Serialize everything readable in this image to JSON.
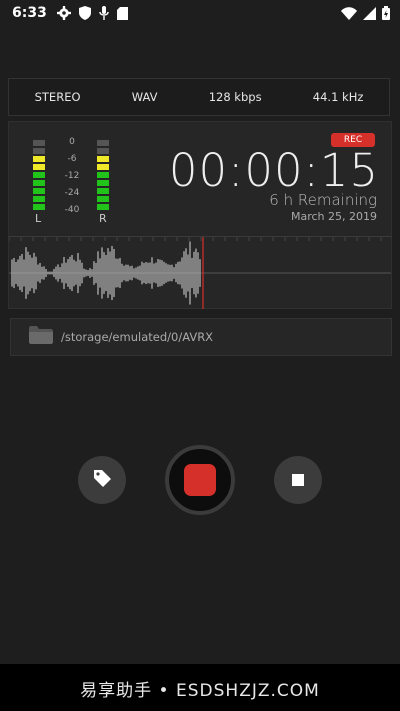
{
  "status_bar": {
    "time": "6:33"
  },
  "info": {
    "channels": "STEREO",
    "format": "WAV",
    "bitrate": "128 kbps",
    "sample_rate": "44.1 kHz"
  },
  "meter": {
    "scale": [
      "0",
      "-6",
      "-12",
      "-24",
      "-40"
    ],
    "left_label": "L",
    "right_label": "R",
    "left_level_segments": 7,
    "right_level_segments": 7,
    "total_segments": 9
  },
  "recording": {
    "badge": "REC",
    "timer": "00:00:15",
    "remaining": "6 h Remaining",
    "date": "March 25, 2019"
  },
  "storage": {
    "path": "/storage/emulated/0/AVRX"
  },
  "colors": {
    "accent_red": "#d6302b",
    "meter_green": "#22c31a",
    "meter_yellow": "#f0e92a"
  },
  "watermark": {
    "text": "易享助手 • ESDSHZJZ.COM"
  }
}
